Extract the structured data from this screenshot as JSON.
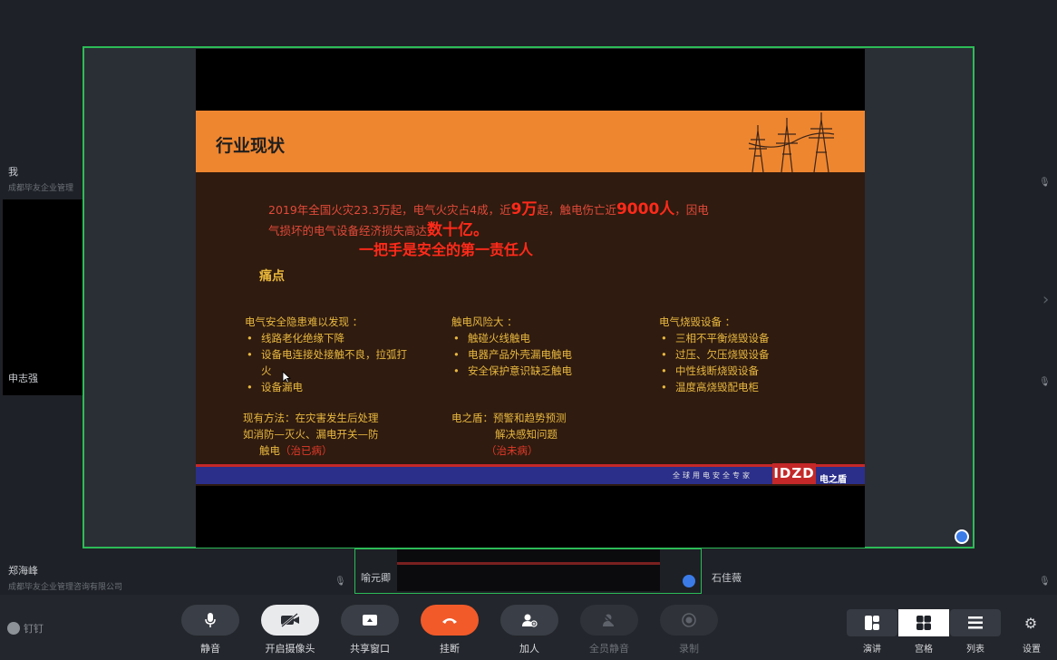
{
  "participants": {
    "me": {
      "name": "我",
      "org": "成都毕友企业管理"
    },
    "left_tile": {
      "name": "申志强"
    },
    "bottom_left": {
      "name": "郑海峰",
      "org": "成都毕友企业管理咨询有限公司"
    },
    "bottom_mid": {
      "name": "喻元卿"
    },
    "bottom_right": {
      "name": "石佳薇"
    }
  },
  "slide": {
    "title": "行业现状",
    "intro_line1_a": "2019年全国火灾23.3万起，电气火灾占4成，近",
    "intro_line1_b": "9万",
    "intro_line1_c": "起，触电伤亡近",
    "intro_line1_d": "9000人",
    "intro_line1_e": "，因电",
    "intro_line2_a": "气损坏的电气设备经济损失高达",
    "intro_line2_b": "数十亿。",
    "emphasis": "一把手是安全的第一责任人",
    "pain_heading": "痛点",
    "col1": {
      "title": "电气安全隐患难以发现 ：",
      "items": [
        "线路老化绝缘下降",
        "设备电连接处接触不良，拉弧打火",
        "设备漏电"
      ]
    },
    "col2": {
      "title": "触电风险大 ：",
      "items": [
        "触碰火线触电",
        "电器产品外壳漏电触电",
        "安全保护意识缺乏触电"
      ]
    },
    "col3": {
      "title": "电气烧毁设备 ：",
      "items": [
        "三相不平衡烧毁设备",
        "过压、欠压烧毁设备",
        "中性线断烧毁设备",
        "温度高烧毁配电柜"
      ]
    },
    "method_left_1": "现有方法：在灾害发生后处理",
    "method_left_2": "如消防—灭火、漏电开关—防",
    "method_left_3a": "触电",
    "method_left_3b": "（治已病）",
    "method_right_1": "电之盾：预警和趋势预测",
    "method_right_2": "解决感知问题",
    "method_right_3": "（治未病）",
    "footer_text": "全球用电安全专家",
    "logo_text": "IDZD",
    "brand_text": "电之盾"
  },
  "toolbar": {
    "app_name": "钉钉",
    "buttons": [
      {
        "label": "静音",
        "icon": "microphone-icon"
      },
      {
        "label": "开启摄像头",
        "icon": "camera-off-icon"
      },
      {
        "label": "共享窗口",
        "icon": "share-screen-icon"
      },
      {
        "label": "挂断",
        "icon": "hang-up-icon"
      },
      {
        "label": "加人",
        "icon": "add-person-icon"
      },
      {
        "label": "全员静音",
        "icon": "mute-all-icon"
      },
      {
        "label": "录制",
        "icon": "record-icon"
      }
    ],
    "views": [
      {
        "label": "演讲",
        "icon": "speaker-view-icon"
      },
      {
        "label": "宫格",
        "icon": "grid-view-icon"
      },
      {
        "label": "列表",
        "icon": "list-view-icon"
      }
    ],
    "settings_label": "设置",
    "colors": {
      "hangup": "#f25a2a",
      "active_border": "#2dbb57"
    }
  }
}
